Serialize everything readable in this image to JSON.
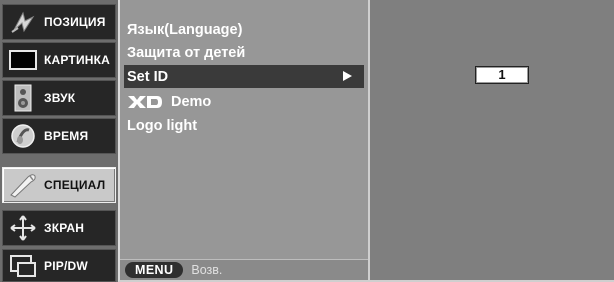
{
  "sidebar": {
    "items": [
      {
        "label": "ПОЗИЦИЯ",
        "icon": "position-icon",
        "active": false
      },
      {
        "label": "КАРТИНКА",
        "icon": "picture-icon",
        "active": false
      },
      {
        "label": "ЗВУК",
        "icon": "speaker-icon",
        "active": false
      },
      {
        "label": "ВРЕМЯ",
        "icon": "time-icon",
        "active": false
      },
      {
        "label": "СПЕЦИАЛ",
        "icon": "special-icon",
        "active": true
      },
      {
        "label": "ЗКРАН",
        "icon": "screen-icon",
        "active": false
      },
      {
        "label": "PIP/DW",
        "icon": "pip-icon",
        "active": false
      }
    ]
  },
  "menu": {
    "items": [
      {
        "label": "Язык(Language)"
      },
      {
        "label": "Защита от детей"
      },
      {
        "label": "Set ID",
        "selected": true
      },
      {
        "label": "Demo",
        "logo": "XD"
      },
      {
        "label": "Logo light"
      }
    ],
    "footer": {
      "button_label": "MENU",
      "hint": "Возв."
    }
  },
  "panel": {
    "set_id_value": "1"
  },
  "colors": {
    "sidebar_bg": "#6d6d6d",
    "menu_bg": "#979797",
    "panel_bg": "#7f7f7f",
    "selected_bg": "#3a3a3a",
    "active_tile": "#c9c9c9"
  }
}
